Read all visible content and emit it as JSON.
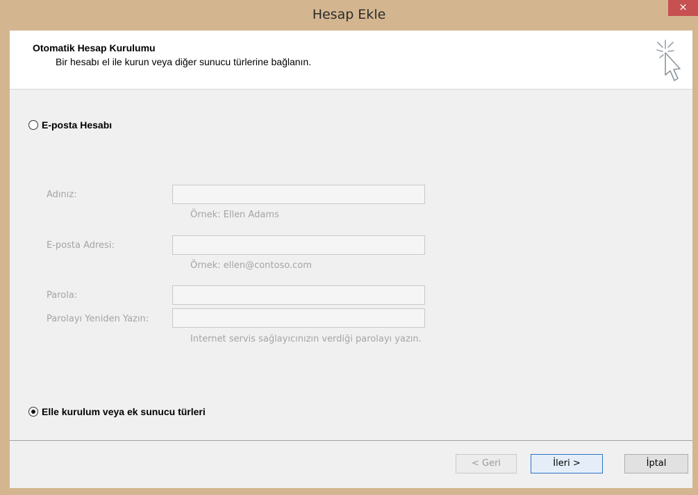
{
  "window": {
    "title": "Hesap Ekle",
    "close_glyph": "×"
  },
  "header": {
    "title": "Otomatik Hesap Kurulumu",
    "subtitle": "Bir hesabı el ile kurun veya diğer sunucu türlerine bağlanın.",
    "icon": "cursor-sparkle-icon"
  },
  "options": {
    "email_account": {
      "label": "E-posta Hesabı",
      "selected": false
    },
    "manual_setup": {
      "label": "Elle kurulum veya ek sunucu türleri",
      "selected": true
    }
  },
  "form": {
    "name": {
      "label": "Adınız:",
      "value": "",
      "hint": "Örnek: Ellen Adams"
    },
    "email": {
      "label": "E-posta Adresi:",
      "value": "",
      "hint": "Örnek: ellen@contoso.com"
    },
    "password": {
      "label": "Parola:",
      "value": ""
    },
    "password_confirm": {
      "label": "Parolayı Yeniden Yazın:",
      "value": "",
      "hint": "Internet servis sağlayıcınızın verdiği parolayı yazın."
    }
  },
  "buttons": {
    "back": "< Geri",
    "next": "İleri >",
    "cancel": "İptal"
  },
  "colors": {
    "frame": "#d3b690",
    "close": "#c75050",
    "disabled_text": "#a4a4a4",
    "default_button_border": "#2c72c7"
  }
}
